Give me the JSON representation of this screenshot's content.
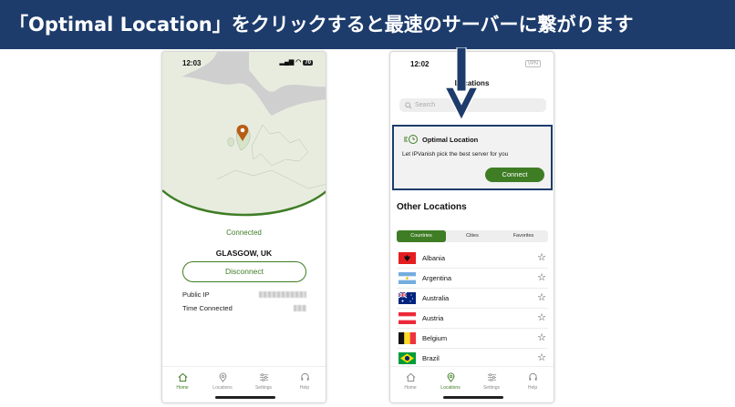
{
  "banner": {
    "text": "「Optimal Location」をクリックすると最速のサーバーに繋がります"
  },
  "colors": {
    "banner_bg": "#1d3c6c",
    "accent_green": "#3f7d25",
    "highlight_border": "#1d3c6c"
  },
  "phone1": {
    "status": {
      "time": "12:03",
      "battery": "70"
    },
    "connection_status": "Connected",
    "city": "GLASGOW, UK",
    "disconnect_label": "Disconnect",
    "public_ip_label": "Public IP",
    "time_connected_label": "Time Connected",
    "map_pin_icon": "location-pin-icon"
  },
  "phone2": {
    "status": {
      "time": "12:02",
      "vpn_badge": "VPN"
    },
    "title": "Locations",
    "search_placeholder": "Search",
    "optimal": {
      "title": "Optimal Location",
      "description": "Let IPVanish pick the best server for you",
      "connect_label": "Connect"
    },
    "other_locations_title": "Other Locations",
    "segments": [
      "Countries",
      "Cities",
      "Favorites"
    ],
    "active_segment": "Countries",
    "countries": [
      {
        "name": "Albania",
        "flag_icon": "albania-flag-icon"
      },
      {
        "name": "Argentina",
        "flag_icon": "argentina-flag-icon"
      },
      {
        "name": "Australia",
        "flag_icon": "australia-flag-icon"
      },
      {
        "name": "Austria",
        "flag_icon": "austria-flag-icon"
      },
      {
        "name": "Belgium",
        "flag_icon": "belgium-flag-icon"
      },
      {
        "name": "Brazil",
        "flag_icon": "brazil-flag-icon"
      }
    ]
  },
  "tabs": [
    {
      "label": "Home",
      "icon": "home-icon"
    },
    {
      "label": "Locations",
      "icon": "location-pin-icon"
    },
    {
      "label": "Settings",
      "icon": "sliders-icon"
    },
    {
      "label": "Help",
      "icon": "headset-icon"
    }
  ]
}
